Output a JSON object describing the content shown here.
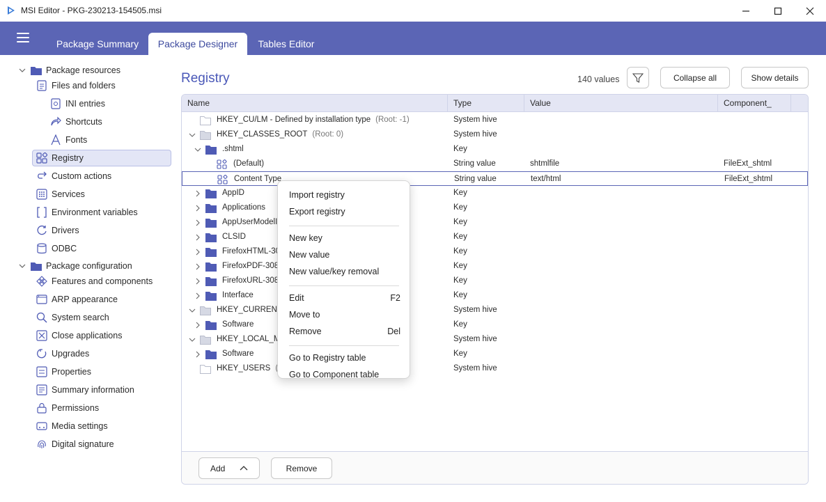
{
  "window": {
    "title": "MSI Editor - PKG-230213-154505.msi",
    "minimize_icon": "minimize-icon",
    "maximize_icon": "maximize-icon",
    "close_icon": "close-icon"
  },
  "tabs": [
    {
      "label": "Package Summary",
      "active": false
    },
    {
      "label": "Package Designer",
      "active": true
    },
    {
      "label": "Tables Editor",
      "active": false
    }
  ],
  "sidebar": {
    "resources_group": "Package resources",
    "resources_items": [
      {
        "label": "Files and folders",
        "icon": "file-icon"
      },
      {
        "label": "INI entries",
        "icon": "ini-icon"
      },
      {
        "label": "Shortcuts",
        "icon": "shortcut-icon"
      },
      {
        "label": "Fonts",
        "icon": "font-icon"
      },
      {
        "label": "Registry",
        "icon": "registry-icon",
        "selected": true
      },
      {
        "label": "Custom actions",
        "icon": "custom-action-icon"
      },
      {
        "label": "Services",
        "icon": "services-icon"
      },
      {
        "label": "Environment variables",
        "icon": "env-vars-icon"
      },
      {
        "label": "Drivers",
        "icon": "drivers-icon"
      },
      {
        "label": "ODBC",
        "icon": "database-icon"
      }
    ],
    "configuration_group": "Package configuration",
    "configuration_items": [
      {
        "label": "Features and components",
        "icon": "features-icon"
      },
      {
        "label": "ARP appearance",
        "icon": "arp-icon"
      },
      {
        "label": "System search",
        "icon": "search-icon"
      },
      {
        "label": "Close applications",
        "icon": "close-apps-icon"
      },
      {
        "label": "Upgrades",
        "icon": "upgrade-icon"
      },
      {
        "label": "Properties",
        "icon": "properties-icon"
      },
      {
        "label": "Summary information",
        "icon": "summary-icon"
      },
      {
        "label": "Permissions",
        "icon": "permissions-icon"
      },
      {
        "label": "Media settings",
        "icon": "media-icon"
      },
      {
        "label": "Digital signature",
        "icon": "fingerprint-icon"
      }
    ]
  },
  "main": {
    "title": "Registry",
    "count": "140 values",
    "filter_icon": "filter-icon",
    "collapse_all": "Collapse all",
    "show_details": "Show details",
    "columns": [
      "Name",
      "Type",
      "Value",
      "Component_"
    ],
    "rows": [
      {
        "name": "HKEY_CU/LM - Defined by installation type",
        "extra": "(Root: -1)",
        "type": "System hive",
        "value": "",
        "component": "",
        "icon": "hive-folder-icon",
        "level": 0,
        "expander": ""
      },
      {
        "name": "HKEY_CLASSES_ROOT",
        "extra": "(Root: 0)",
        "type": "System hive",
        "value": "",
        "component": "",
        "icon": "hive-folder-icon",
        "level": 0,
        "expander": "down"
      },
      {
        "name": ".shtml",
        "extra": "",
        "type": "Key",
        "value": "",
        "component": "",
        "icon": "key-folder-icon",
        "level": 1,
        "expander": "down"
      },
      {
        "name": "(Default)",
        "extra": "",
        "type": "String value",
        "value": "shtmlfile",
        "component": "FileExt_shtml",
        "icon": "registry-value-icon",
        "level": 2,
        "expander": ""
      },
      {
        "name": "Content Type",
        "extra": "",
        "type": "String value",
        "value": "text/html",
        "component": "FileExt_shtml",
        "icon": "registry-value-icon",
        "level": 2,
        "expander": "",
        "selected": true
      },
      {
        "name": "AppID",
        "extra": "",
        "type": "Key",
        "value": "",
        "component": "",
        "icon": "key-folder-icon",
        "level": 1,
        "expander": "right"
      },
      {
        "name": "Applications",
        "extra": "",
        "type": "Key",
        "value": "",
        "component": "",
        "icon": "key-folder-icon",
        "level": 1,
        "expander": "right"
      },
      {
        "name": "AppUserModelId",
        "extra": "",
        "type": "Key",
        "value": "",
        "component": "",
        "icon": "key-folder-icon",
        "level": 1,
        "expander": "right"
      },
      {
        "name": "CLSID",
        "extra": "",
        "type": "Key",
        "value": "",
        "component": "",
        "icon": "key-folder-icon",
        "level": 1,
        "expander": "right"
      },
      {
        "name": "FirefoxHTML-308046B0AF4A39CB",
        "extra": "",
        "type": "Key",
        "value": "",
        "component": "",
        "icon": "key-folder-icon",
        "level": 1,
        "expander": "right"
      },
      {
        "name": "FirefoxPDF-308046B0AF4A39CB",
        "extra": "",
        "type": "Key",
        "value": "",
        "component": "",
        "icon": "key-folder-icon",
        "level": 1,
        "expander": "right"
      },
      {
        "name": "FirefoxURL-308046B0AF4A39CB",
        "extra": "",
        "type": "Key",
        "value": "",
        "component": "",
        "icon": "key-folder-icon",
        "level": 1,
        "expander": "right"
      },
      {
        "name": "Interface",
        "extra": "",
        "type": "Key",
        "value": "",
        "component": "",
        "icon": "key-folder-icon",
        "level": 1,
        "expander": "right"
      },
      {
        "name": "HKEY_CURRENT_USER",
        "extra": "",
        "type": "System hive",
        "value": "",
        "component": "",
        "icon": "hive-folder-icon",
        "level": 0,
        "expander": "down"
      },
      {
        "name": "Software",
        "extra": "",
        "type": "Key",
        "value": "",
        "component": "",
        "icon": "key-folder-icon",
        "level": 1,
        "expander": "right"
      },
      {
        "name": "HKEY_LOCAL_MACHINE",
        "extra": "",
        "type": "System hive",
        "value": "",
        "component": "",
        "icon": "hive-folder-icon",
        "level": 0,
        "expander": "down"
      },
      {
        "name": "Software",
        "extra": "",
        "type": "Key",
        "value": "",
        "component": "",
        "icon": "key-folder-icon",
        "level": 1,
        "expander": "right"
      },
      {
        "name": "HKEY_USERS",
        "extra": "(Root: 3)",
        "type": "System hive",
        "value": "",
        "component": "",
        "icon": "hive-folder-icon",
        "level": 0,
        "expander": ""
      }
    ],
    "add_button": "Add",
    "add_chevron_icon": "chevron-up-icon",
    "remove_button": "Remove"
  },
  "context_menu": {
    "groups": [
      [
        {
          "label": "Import registry",
          "shortcut": ""
        },
        {
          "label": "Export registry",
          "shortcut": ""
        }
      ],
      [
        {
          "label": "New key",
          "shortcut": ""
        },
        {
          "label": "New value",
          "shortcut": ""
        },
        {
          "label": "New value/key removal",
          "shortcut": ""
        }
      ],
      [
        {
          "label": "Edit",
          "shortcut": "F2"
        },
        {
          "label": "Move to",
          "shortcut": ""
        },
        {
          "label": "Remove",
          "shortcut": "Del"
        }
      ],
      [
        {
          "label": "Go to Registry table",
          "shortcut": ""
        },
        {
          "label": "Go to Component table",
          "shortcut": ""
        }
      ]
    ]
  },
  "colors": {
    "accent": "#5b65b5",
    "title_accent": "#4a58b8",
    "selection_bg": "#e3e6f6",
    "folder_blue": "#4f5bb5",
    "hive_folder": "#d6d9e4"
  }
}
